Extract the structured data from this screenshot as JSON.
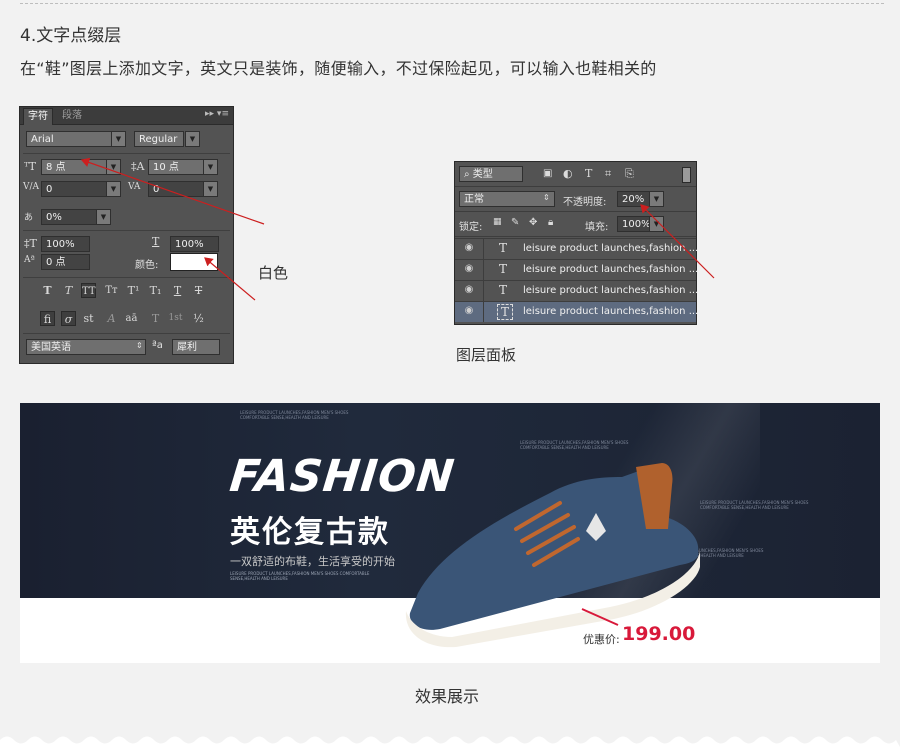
{
  "heading": "4.文字点缀层",
  "description": "在“鞋”图层上添加文字，英文只是装饰，随便输入，不过保险起见，可以输入也鞋相关的",
  "char_panel": {
    "tab_character": "字符",
    "tab_paragraph": "段落",
    "font_family": "Arial",
    "font_style": "Regular",
    "font_size": "8 点",
    "leading": "10 点",
    "kerning": "0",
    "tracking": "0",
    "scale_percent": "0%",
    "vertical_scale": "100%",
    "horizontal_scale": "100%",
    "baseline_shift": "0 点",
    "color_label": "颜色:",
    "color_value": "#ffffff",
    "style_buttons": [
      "T",
      "T",
      "TT",
      "Tт",
      "T¹",
      "T₁",
      "T",
      "T"
    ],
    "opentype_buttons": [
      "fi",
      "σ",
      "st",
      "A",
      "aā",
      "T",
      "1st",
      "½"
    ],
    "language": "美国英语",
    "aa_label": "ªa",
    "antialias": "犀利"
  },
  "annotation_white": "白色",
  "layers_panel": {
    "filter_label": "类型",
    "blend_mode": "正常",
    "opacity_label": "不透明度:",
    "opacity_value": "20%",
    "lock_label": "锁定:",
    "fill_label": "填充:",
    "fill_value": "100%",
    "layers": [
      {
        "name": "leisure product launches,fashion ..."
      },
      {
        "name": "leisure product launches,fashion ..."
      },
      {
        "name": "leisure product launches,fashion ..."
      },
      {
        "name": "leisure product launches,fashion ..."
      }
    ]
  },
  "annotation_layers": "图层面板",
  "banner": {
    "headline_en": "FASHION",
    "headline_cn": "英伦复古款",
    "slogan": "一双舒适的布鞋，生活享受的开始",
    "slogan_en": "LEISURE PRODUCT LAUNCHES,FASHION MEN'S SHOES COMFORTABLE SENSE,HEALTH AND LEISURE",
    "deco_text": "LEISURE PRODUCT LAUNCHES,FASHION MEN'S SHOES COMFORTABLE SENSE,HEALTH AND LEISURE",
    "price_label": "优惠价:",
    "price": "199.00"
  },
  "annotation_effect": "效果展示",
  "colors": {
    "background": "#f2f2f2",
    "panel": "#535353",
    "selected_layer": "#5e6b80",
    "price": "#d8193a",
    "arrow": "#cc1f1f"
  }
}
